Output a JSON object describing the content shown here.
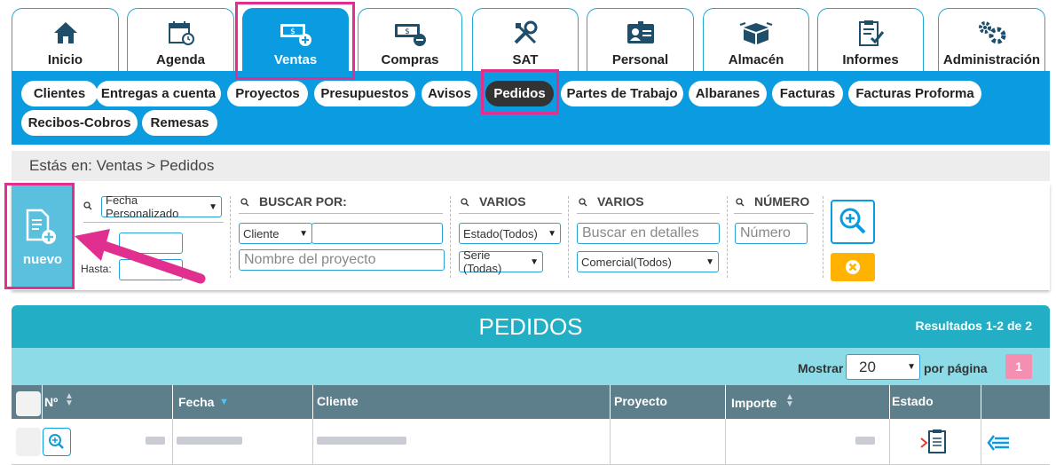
{
  "modules": [
    {
      "label": "Inicio",
      "icon": "home-icon"
    },
    {
      "label": "Agenda",
      "icon": "calendar-icon"
    },
    {
      "label": "Ventas",
      "icon": "money-plus-icon",
      "active": true
    },
    {
      "label": "Compras",
      "icon": "money-minus-icon"
    },
    {
      "label": "SAT",
      "icon": "tools-icon"
    },
    {
      "label": "Personal",
      "icon": "id-card-icon"
    },
    {
      "label": "Almacén",
      "icon": "boxes-icon"
    },
    {
      "label": "Informes",
      "icon": "clipboard-check-icon"
    },
    {
      "label": "Administración",
      "icon": "gears-icon"
    }
  ],
  "submenu": [
    {
      "label": "Clientes"
    },
    {
      "label": "Entregas a cuenta"
    },
    {
      "label": "Proyectos"
    },
    {
      "label": "Presupuestos"
    },
    {
      "label": "Avisos"
    },
    {
      "label": "Pedidos",
      "active": true
    },
    {
      "label": "Partes de Trabajo"
    },
    {
      "label": "Albaranes"
    },
    {
      "label": "Facturas"
    },
    {
      "label": "Facturas Proforma"
    },
    {
      "label": "Recibos-Cobros"
    },
    {
      "label": "Remesas"
    }
  ],
  "breadcrumb": "Estás en: Ventas > Pedidos",
  "nuevo_label": "nuevo",
  "filters": {
    "date_type": "Fecha Personalizado",
    "hasta_label": "Hasta:",
    "buscar_title": "BUSCAR POR:",
    "cliente_select": "Cliente",
    "nombre_proyecto_placeholder": "Nombre del proyecto",
    "varios1_title": "VARIOS",
    "estado_select": "Estado(Todos)",
    "serie_select": "Serie (Todas)",
    "varios2_title": "VARIOS",
    "detalles_placeholder": "Buscar en detalles",
    "comercial_select": "Comercial(Todos)",
    "numero_title": "NÚMERO",
    "numero_placeholder": "Número"
  },
  "results": {
    "title": "PEDIDOS",
    "count": "Resultados 1-2 de 2",
    "mostrar_label": "Mostrar",
    "per_page": "20",
    "por_pagina_label": "por página",
    "page": "1"
  },
  "table": {
    "columns": [
      "Nº",
      "Fecha",
      "Cliente",
      "Proyecto",
      "Importe",
      "Estado"
    ]
  },
  "colors": {
    "primary": "#0a9be0",
    "highlight": "#e02f8e",
    "header": "#22aec4",
    "table_head": "#5d7f8c"
  }
}
